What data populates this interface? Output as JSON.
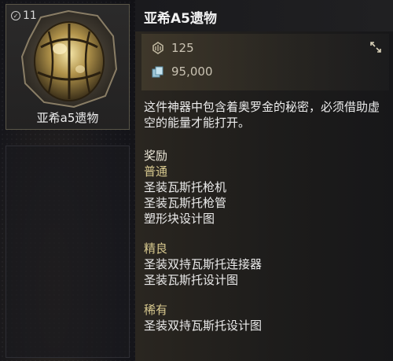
{
  "item_card": {
    "count": "11",
    "name": "亚希a5遗物"
  },
  "tooltip": {
    "title": "亚希A5遗物",
    "stats": [
      {
        "icon": "ducat-icon",
        "value": "125"
      },
      {
        "icon": "credits-icon",
        "value": "95,000"
      }
    ],
    "description": "这件神器中包含着奥罗金的秘密，必须借助虚空的能量才能打开。",
    "rewards_heading": "奖励",
    "tiers": [
      {
        "name": "普通",
        "items": [
          "圣装瓦斯托枪机",
          "圣装瓦斯托枪管",
          "塑形块设计图"
        ]
      },
      {
        "name": "精良",
        "items": [
          "圣装双持瓦斯托连接器",
          "圣装瓦斯托设计图"
        ]
      },
      {
        "name": "稀有",
        "items": [
          "圣装双持瓦斯托设计图"
        ]
      }
    ]
  },
  "colors": {
    "tier_label": "#d8c98f",
    "panel_bg": "#2a2620"
  }
}
